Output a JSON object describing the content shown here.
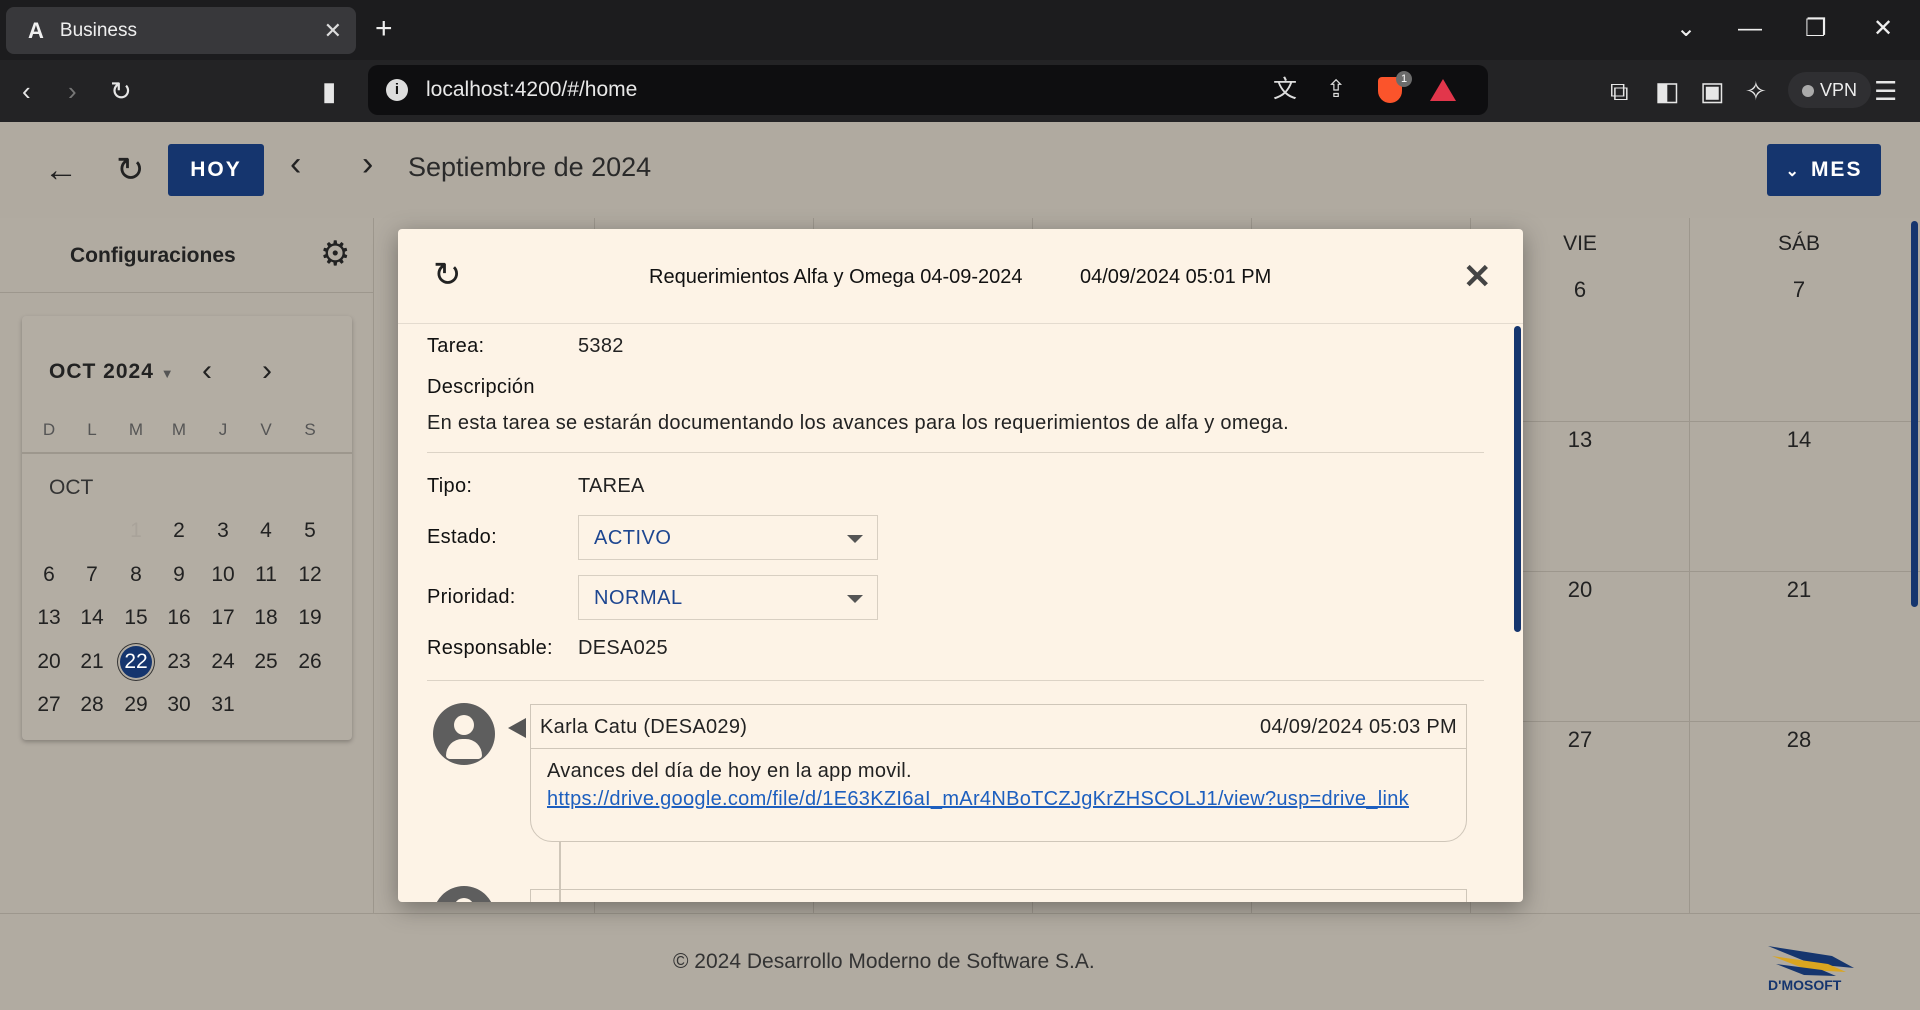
{
  "browser": {
    "tab_title": "Business",
    "tab_logo": "A",
    "url": "localhost:4200/#/home",
    "vpn_label": "VPN",
    "brave_badge": "1"
  },
  "header": {
    "today_label": "HOY",
    "month_label": "Septiembre de 2024",
    "view_label": "MES"
  },
  "sidebar": {
    "config_title": "Configuraciones",
    "mini_calendar": {
      "title": "OCT 2024",
      "month_short": "OCT",
      "weekdays": [
        "D",
        "L",
        "M",
        "M",
        "J",
        "V",
        "S"
      ],
      "first_day": "1",
      "weeks": [
        [
          "",
          "",
          "",
          "2",
          "3",
          "4",
          "5"
        ],
        [
          "6",
          "7",
          "8",
          "9",
          "10",
          "11",
          "12"
        ],
        [
          "13",
          "14",
          "15",
          "16",
          "17",
          "18",
          "19"
        ],
        [
          "20",
          "21",
          "22",
          "23",
          "24",
          "25",
          "26"
        ],
        [
          "27",
          "28",
          "29",
          "30",
          "31",
          "",
          ""
        ]
      ],
      "selected_day": "22"
    }
  },
  "calendar": {
    "visible_weekdays": [
      "VIE",
      "SÁB"
    ],
    "rows": [
      [
        "6",
        "7"
      ],
      [
        "13",
        "14"
      ],
      [
        "20",
        "21"
      ],
      [
        "27",
        "28"
      ]
    ]
  },
  "modal": {
    "title": "Requerimientos Alfa y Omega 04-09-2024",
    "datetime": "04/09/2024 05:01 PM",
    "task_label": "Tarea:",
    "task_value": "5382",
    "description_label": "Descripción",
    "description_text": "En esta tarea se estarán documentando los avances para los requerimientos de alfa y omega.",
    "type_label": "Tipo:",
    "type_value": "TAREA",
    "status_label": "Estado:",
    "status_value": "ACTIVO",
    "priority_label": "Prioridad:",
    "priority_value": "NORMAL",
    "owner_label": "Responsable:",
    "owner_value": "DESA025",
    "comments": [
      {
        "author": "Karla Catu (DESA029)",
        "date": "04/09/2024 05:03 PM",
        "text": "Avances del día de hoy en la app movil.",
        "link": "https://drive.google.com/file/d/1E63KZI6aI_mAr4NBoTCZJgKrZHSCOLJ1/view?usp=drive_link"
      }
    ]
  },
  "footer": {
    "copyright": "© 2024 Desarrollo Moderno de Software S.A.",
    "logo_text": "D'MOSOFT"
  }
}
